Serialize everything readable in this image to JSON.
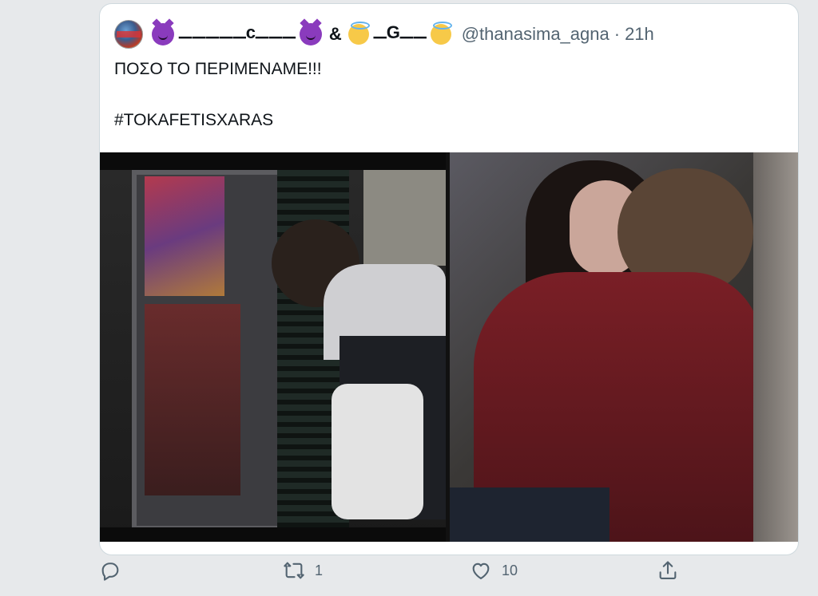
{
  "tweet": {
    "display_name_parts": [
      "𝍠𝍠𝍠𝍠𝍠c𝍠𝍠𝍠",
      "&",
      "𝍠G𝍠𝍠"
    ],
    "handle": "@thanasima_agna",
    "separator": "·",
    "time": "21h",
    "text_line1": "ΠΟΣΟ ΤΟ ΠΕΡΙΜΕΝΑΜΕ!!!",
    "text_line2": "#TOKAFETISXARAS"
  },
  "actions": {
    "reply_count": "",
    "retweet_count": "1",
    "like_count": "10"
  },
  "icons": [
    "avatar",
    "devil-emoji-icon",
    "angel-emoji-icon",
    "reply-icon",
    "retweet-icon",
    "like-icon",
    "share-icon"
  ],
  "colors": {
    "text": "#0f1419",
    "secondary": "#536471",
    "border": "#cfd9de",
    "background": "#e7e9eb"
  }
}
